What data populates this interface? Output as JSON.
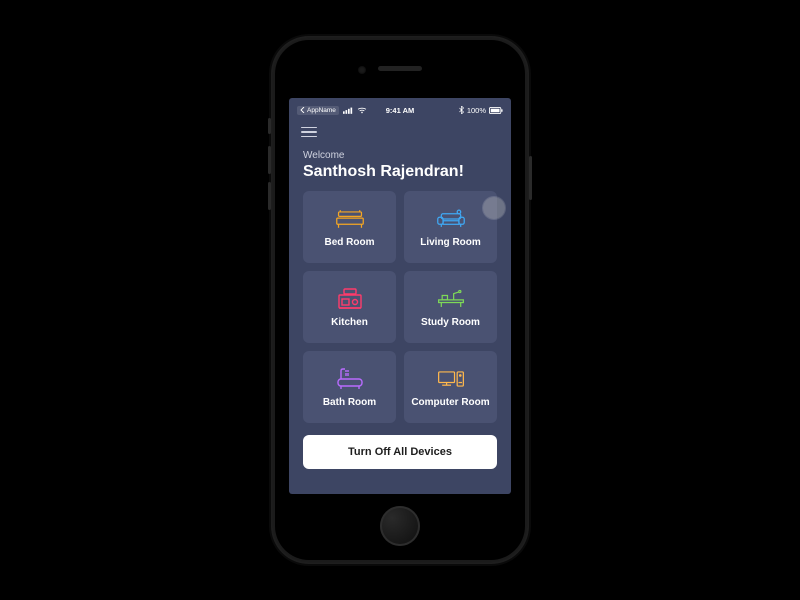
{
  "status_bar": {
    "back_app": "AppName",
    "time": "9:41 AM",
    "bluetooth_icon": "bluetooth",
    "battery_pct": "100%"
  },
  "header": {
    "welcome_label": "Welcome",
    "user_name": "Santhosh Rajendran!"
  },
  "rooms": [
    {
      "label": "Bed Room",
      "icon": "bed-icon",
      "icon_color": "#f5a623"
    },
    {
      "label": "Living Room",
      "icon": "sofa-icon",
      "icon_color": "#3fa9f5"
    },
    {
      "label": "Kitchen",
      "icon": "kitchen-icon",
      "icon_color": "#ff3b6b"
    },
    {
      "label": "Study Room",
      "icon": "desk-icon",
      "icon_color": "#7ed957"
    },
    {
      "label": "Bath Room",
      "icon": "bath-icon",
      "icon_color": "#b96bff"
    },
    {
      "label": "Computer Room",
      "icon": "computer-icon",
      "icon_color": "#ffb84d"
    }
  ],
  "buttons": {
    "turn_off_all": "Turn Off All Devices"
  },
  "touch_indicator": {
    "tile_index": 1
  }
}
